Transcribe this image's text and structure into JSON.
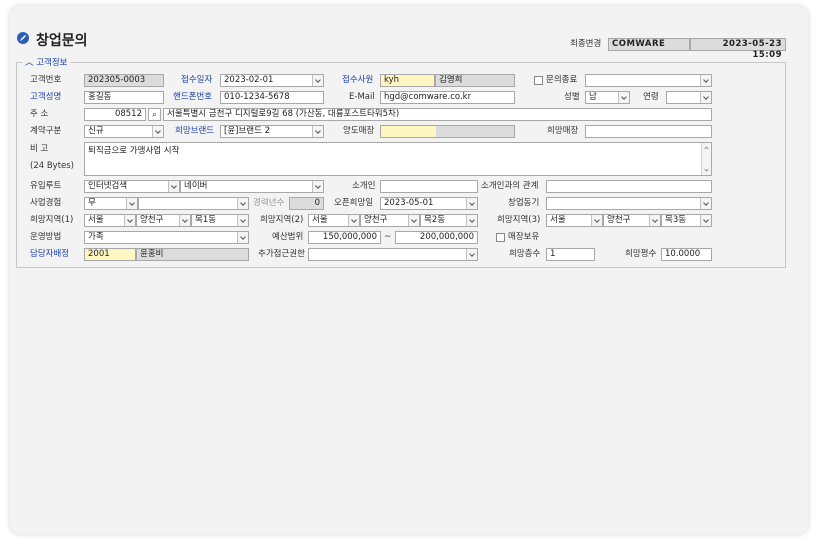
{
  "header": {
    "title": "창업문의",
    "last_changed_label": "최종변경",
    "last_changed_user": "COMWARE",
    "last_changed_datetime": "2023-05-23 15:09"
  },
  "group": {
    "title": "고객정보"
  },
  "fields": {
    "customer_no_label": "고객번호",
    "customer_no": "202305-0003",
    "received_date_label": "접수일자",
    "received_date": "2023-02-01",
    "receiver_label": "접수사원",
    "receiver_id": "kyh",
    "receiver_name": "김영희",
    "inquiry_end_label": "문의종료",
    "inquiry_end_value": "",
    "customer_name_label": "고객성명",
    "customer_name": "홍길동",
    "mobile_label": "핸드폰번호",
    "mobile": "010-1234-5678",
    "email_label": "E-Mail",
    "email": "hgd@comware.co.kr",
    "gender_label": "성별",
    "gender": "남",
    "age_label": "연령",
    "age": "",
    "address_label": "주    소",
    "zip": "08512",
    "address": "서울특별시 금천구 디지털로9길 68 (가산동, 대륭포스트타워5차)",
    "contract_type_label": "계약구분",
    "contract_type": "신규",
    "desired_brand_label": "희망브랜드",
    "desired_brand": "[윤]브랜드 2",
    "transfer_store_label": "양도매장",
    "desired_store_label": "희망매장",
    "desired_store": "",
    "memo_label": "비    고",
    "memo_bytes": "(24 Bytes)",
    "memo": "퇴직금으로 가맹사업 시작",
    "inflow_route_label": "유입루트",
    "inflow_route_1": "인터넷검색",
    "inflow_route_2": "네이버",
    "referrer_label": "소개인",
    "referrer": "",
    "referrer_relation_label": "소개인과의 관계",
    "referrer_relation": "",
    "biz_experience_label": "사업경험",
    "biz_experience": "무",
    "biz_experience_detail": "",
    "career_years_label": "경력년수",
    "career_years": "0",
    "desired_open_label": "오픈희망일",
    "desired_open": "2023-05-01",
    "startup_motive_label": "창업동기",
    "startup_motive": "",
    "region1_label": "희망지역(1)",
    "region1_city": "서울",
    "region1_district": "양천구",
    "region1_dong": "목1동",
    "region2_label": "희망지역(2)",
    "region2_city": "서울",
    "region2_district": "양천구",
    "region2_dong": "목2동",
    "region3_label": "희망지역(3)",
    "region3_city": "서울",
    "region3_district": "양천구",
    "region3_dong": "목3동",
    "operation_label": "운영방법",
    "operation": "가족",
    "budget_label": "예산범위",
    "budget_from": "150,000,000",
    "budget_sep": "~",
    "budget_to": "200,000,000",
    "store_owned_label": "매장보유",
    "manager_label": "담당자배정",
    "manager_id": "2001",
    "manager_name": "윤홍비",
    "extra_access_label": "추가접근권한",
    "extra_access": "",
    "desired_floor_label": "희망층수",
    "desired_floor": "1",
    "desired_area_label": "희망평수",
    "desired_area": "10.0000"
  }
}
